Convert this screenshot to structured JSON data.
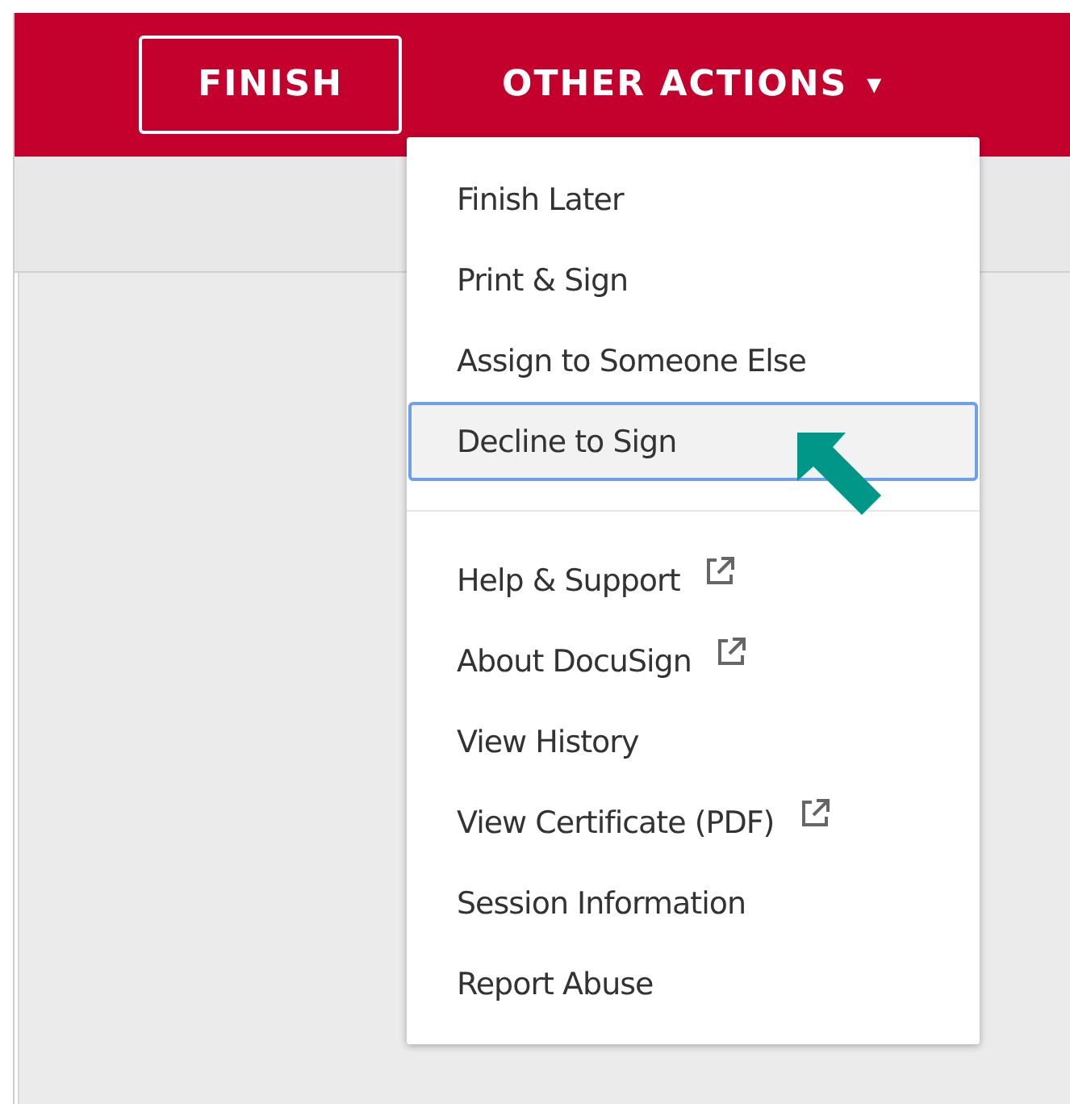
{
  "toolbar": {
    "finish_button": "FINISH",
    "other_actions": {
      "label": "OTHER ACTIONS",
      "caret": "▾"
    }
  },
  "menu": {
    "groups": [
      {
        "items": [
          {
            "label": "Finish Later",
            "selected": false,
            "external": false
          },
          {
            "label": "Print & Sign",
            "selected": false,
            "external": false
          },
          {
            "label": "Assign to Someone Else",
            "selected": false,
            "external": false
          },
          {
            "label": "Decline to Sign",
            "selected": true,
            "external": false
          }
        ]
      },
      {
        "items": [
          {
            "label": "Help & Support",
            "selected": false,
            "external": true
          },
          {
            "label": "About DocuSign",
            "selected": false,
            "external": true
          },
          {
            "label": "View History",
            "selected": false,
            "external": false
          },
          {
            "label": "View Certificate (PDF)",
            "selected": false,
            "external": true
          },
          {
            "label": "Session Information",
            "selected": false,
            "external": false
          },
          {
            "label": "Report Abuse",
            "selected": false,
            "external": false
          }
        ]
      }
    ]
  }
}
